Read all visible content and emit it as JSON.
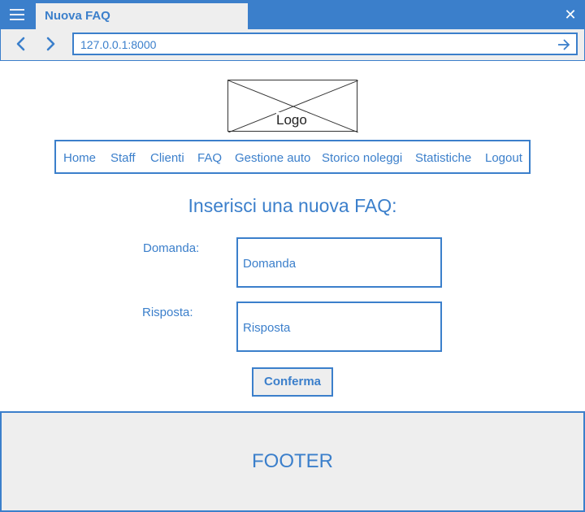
{
  "window": {
    "tab_title": "Nuova FAQ",
    "menu_icon": "hamburger-icon",
    "close_icon": "close-icon"
  },
  "address_bar": {
    "url": "127.0.0.1:8000",
    "back_icon": "chevron-left-icon",
    "forward_icon": "chevron-right-icon",
    "go_icon": "arrow-right-icon"
  },
  "logo": {
    "label": "Logo"
  },
  "nav": {
    "items": [
      {
        "label": "Home"
      },
      {
        "label": "Staff"
      },
      {
        "label": "Clienti"
      },
      {
        "label": "FAQ"
      },
      {
        "label": "Gestione auto"
      },
      {
        "label": "Storico noleggi"
      },
      {
        "label": "Statistiche"
      },
      {
        "label": "Logout"
      }
    ]
  },
  "form": {
    "heading": "Inserisci una nuova FAQ:",
    "question_label": "Domanda:",
    "question_value": "Domanda",
    "answer_label": "Risposta:",
    "answer_value": "Risposta",
    "confirm_label": "Conferma"
  },
  "footer": {
    "text": "FOOTER"
  },
  "colors": {
    "accent": "#3b7fcb",
    "surface": "#eeeeee",
    "background": "#ffffff"
  }
}
